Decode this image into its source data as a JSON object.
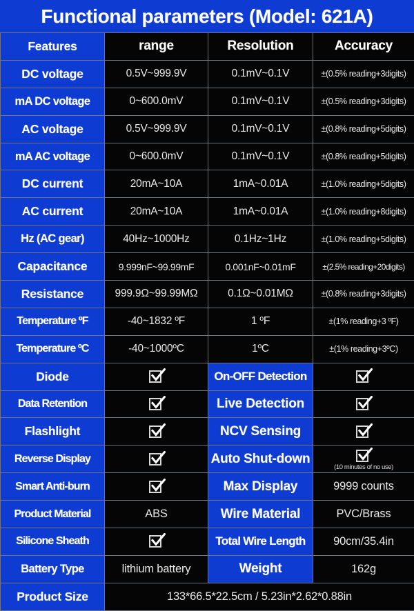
{
  "title": "Functional parameters (Model: 621A)",
  "icons": {
    "check": "check-icon"
  },
  "colors": {
    "brand_blue": "#0e3bd2",
    "cell_black": "#050505",
    "grid": "#6f7480",
    "text": "#ffffff",
    "footer_green": "#1e9c2e"
  },
  "header": {
    "features": "Features",
    "range": "range",
    "resolution": "Resolution",
    "accuracy": "Accuracy"
  },
  "spec_rows": [
    {
      "feature": "DC voltage",
      "range": "0.5V~999.9V",
      "resolution": "0.1mV~0.1V",
      "accuracy": "±(0.5% reading+3digits)"
    },
    {
      "feature": "mA DC voltage",
      "range": "0~600.0mV",
      "resolution": "0.1mV~0.1V",
      "accuracy": "±(0.5% reading+3digits)"
    },
    {
      "feature": "AC voltage",
      "range": "0.5V~999.9V",
      "resolution": "0.1mV~0.1V",
      "accuracy": "±(0.8% reading+5digits)"
    },
    {
      "feature": "mA AC voltage",
      "range": "0~600.0mV",
      "resolution": "0.1mV~0.1V",
      "accuracy": "±(0.8% reading+5digits)"
    },
    {
      "feature": "DC current",
      "range": "20mA~10A",
      "resolution": "1mA~0.01A",
      "accuracy": "±(1.0% reading+5digits)"
    },
    {
      "feature": "AC current",
      "range": "20mA~10A",
      "resolution": "1mA~0.01A",
      "accuracy": "±(1.0% reading+8digits)"
    },
    {
      "feature": "Hz (AC gear)",
      "range": "40Hz~1000Hz",
      "resolution": "0.1Hz~1Hz",
      "accuracy": "±(1.0% reading+5digits)"
    },
    {
      "feature": "Capacitance",
      "range": "9.999nF~99.99mF",
      "resolution": "0.001nF~0.01mF",
      "accuracy": "±(2.5% reading+20digits)"
    },
    {
      "feature": "Resistance",
      "range": "999.9Ω~99.99MΩ",
      "resolution": "0.1Ω~0.01MΩ",
      "accuracy": "±(0.8% reading+3digits)"
    },
    {
      "feature": "Temperature ºF",
      "range": "-40~1832 ºF",
      "resolution": "1 ºF",
      "accuracy": "±(1% reading+3 ºF)"
    },
    {
      "feature": "Temperature ºC",
      "range": "-40~1000ºC",
      "resolution": "1ºC",
      "accuracy": "±(1% reading+3ºC)"
    }
  ],
  "feature_rows": [
    {
      "left_label": "Diode",
      "left_value": "check",
      "right_label": "On-OFF Detection",
      "right_value": "check"
    },
    {
      "left_label": "Data Retention",
      "left_value": "check",
      "right_label": "Live Detection",
      "right_value": "check"
    },
    {
      "left_label": "Flashlight",
      "left_value": "check",
      "right_label": "NCV  Sensing",
      "right_value": "check"
    },
    {
      "left_label": "Reverse Display",
      "left_value": "check",
      "right_label": "Auto Shut-down",
      "right_value": "check",
      "right_note": "(10 minutes of no use)"
    },
    {
      "left_label": "Smart Anti-burn",
      "left_value": "check",
      "right_label": "Max Display",
      "right_value": "9999 counts"
    },
    {
      "left_label": "Product Material",
      "left_value": "ABS",
      "right_label": "Wire Material",
      "right_value": "PVC/Brass"
    },
    {
      "left_label": "Silicone Sheath",
      "left_value": "check",
      "right_label": "Total Wire Length",
      "right_value": "90cm/35.4in"
    },
    {
      "left_label": "Battery Type",
      "left_value": "lithium battery",
      "right_label": "Weight",
      "right_value": "162g"
    }
  ],
  "product_size": {
    "label": "Product Size",
    "value": "133*66.5*22.5cm  /  5.23in*2.62*0.88in"
  }
}
